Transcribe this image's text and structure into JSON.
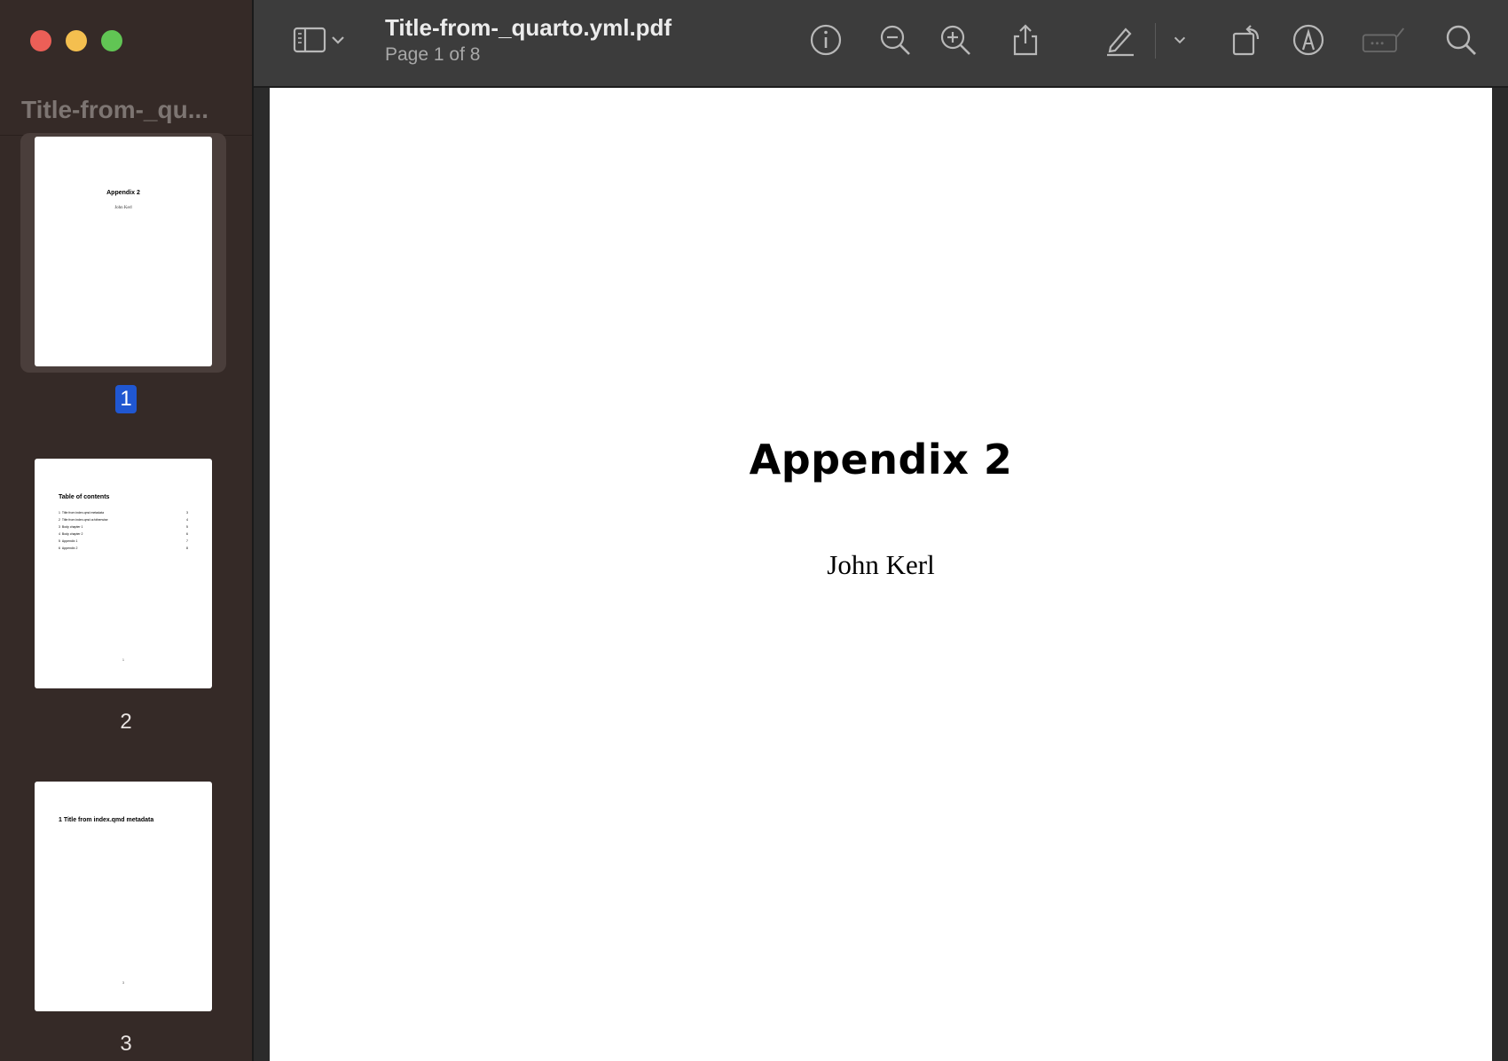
{
  "sidebar": {
    "title": "Title-from-_qu...",
    "thumbnails": [
      {
        "page_label": "1",
        "title": "Appendix 2",
        "author": "John Kerl"
      },
      {
        "page_label": "2",
        "heading": "Table of contents",
        "toc": [
          {
            "num": "1",
            "label": "Title from index.qmd metadata",
            "page": "3"
          },
          {
            "num": "2",
            "label": "Title from index.qmd or/otherwise",
            "page": "4"
          },
          {
            "num": "3",
            "label": "Body chapter 1",
            "page": "5"
          },
          {
            "num": "4",
            "label": "Body chapter 2",
            "page": "6"
          },
          {
            "num": "5",
            "label": "Appendix 1",
            "page": "7"
          },
          {
            "num": "6",
            "label": "Appendix 2",
            "page": "8"
          }
        ],
        "footer": "1"
      },
      {
        "page_label": "3",
        "heading": "1  Title from index.qmd metadata",
        "footer": "3"
      }
    ]
  },
  "toolbar": {
    "doc_title": "Title-from-_quarto.yml.pdf",
    "doc_subtitle": "Page 1 of 8",
    "icons": [
      "sidebar-toggle-icon",
      "chevron-down-icon",
      "info-icon",
      "zoom-out-icon",
      "zoom-in-icon",
      "share-icon",
      "highlight-pen-icon",
      "chevron-down-icon",
      "rotate-icon",
      "markup-icon",
      "sign-icon",
      "search-icon"
    ]
  },
  "document": {
    "title": "Appendix 2",
    "author": "John Kerl"
  },
  "colors": {
    "sidebar_bg": "#352a27",
    "toolbar_bg": "#3c3c3c",
    "selection_blue": "#2057d1"
  }
}
